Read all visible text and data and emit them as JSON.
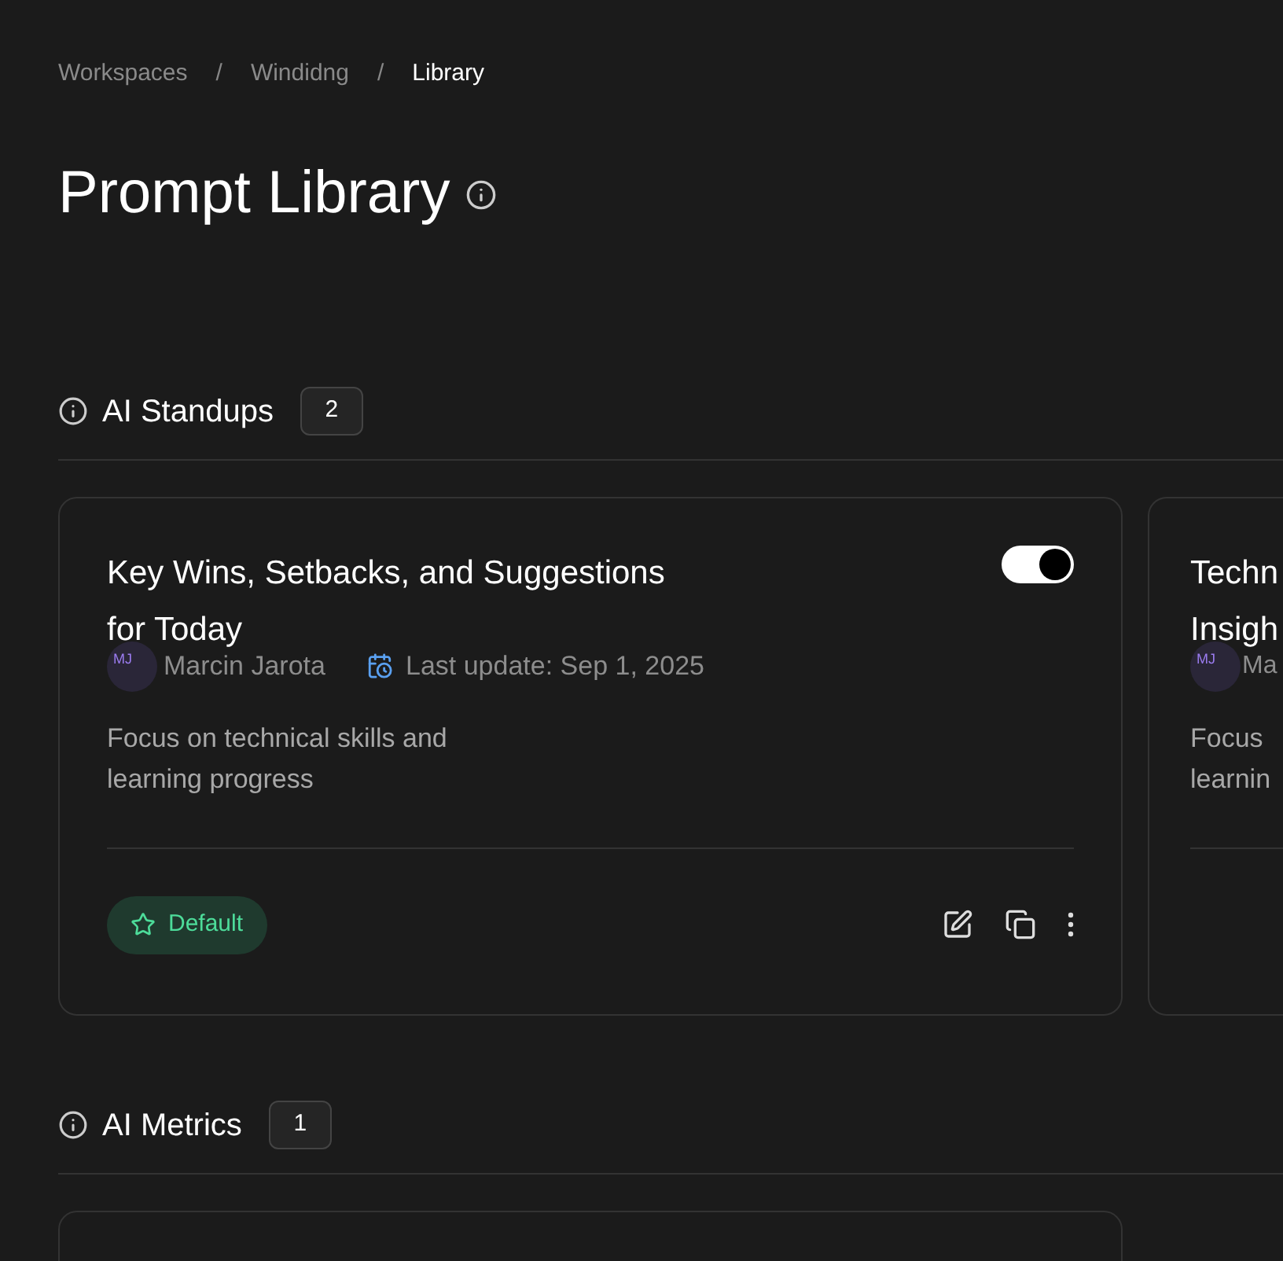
{
  "breadcrumbs": [
    {
      "label": "Workspaces",
      "selected": false
    },
    {
      "label": "Windidng",
      "selected": false
    },
    {
      "label": "Library",
      "selected": true
    }
  ],
  "breadcrumb_separators": [
    "/",
    "/"
  ],
  "page_title": "Prompt Library",
  "sections": [
    {
      "title": "AI Standups",
      "count": "2",
      "cards": [
        {
          "kind": "full",
          "title_lines": [
            "Key Wins, Setbacks, and Suggestions",
            "for Today"
          ],
          "enabled": true,
          "avatar_initials": "MJ",
          "author": "Marcin Jarota",
          "updated": "Last update: Sep 1, 2025",
          "description_lines": [
            "Focus on technical skills and",
            "learning progress"
          ],
          "badge": "Default"
        },
        {
          "kind": "clipped",
          "title_lines": [
            "Techn",
            "Insigh"
          ],
          "avatar_initials": "MJ",
          "author": "Ma",
          "description_lines": [
            "Focus",
            "learnin"
          ]
        }
      ]
    },
    {
      "title": "AI Metrics",
      "count": "1",
      "cards": [
        {
          "kind": "stub"
        }
      ]
    }
  ]
}
